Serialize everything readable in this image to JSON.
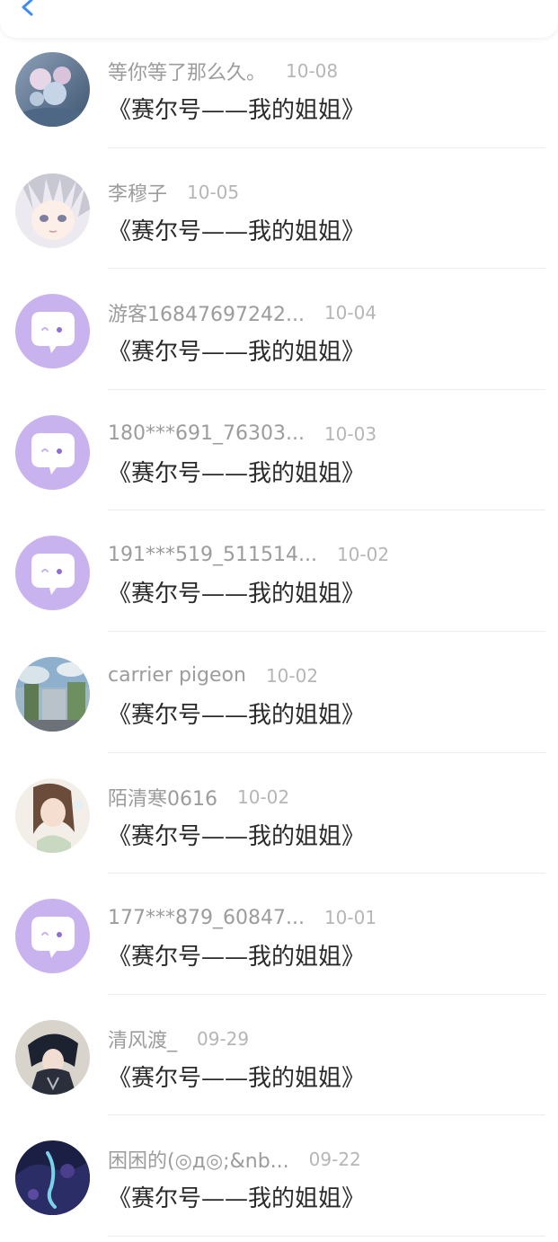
{
  "header": {
    "back_icon": "chevron-left-icon",
    "accent_color": "#3d8bff"
  },
  "messages": [
    {
      "name": "等你等了那么久。",
      "date": "10-08",
      "text": "《赛尔号——我的姐姐》",
      "avatar": "photo-avatar"
    },
    {
      "name": "李穆子",
      "date": "10-05",
      "text": "《赛尔号——我的姐姐》",
      "avatar": "anime-avatar"
    },
    {
      "name": "游客16847697242...",
      "date": "10-04",
      "text": "《赛尔号——我的姐姐》",
      "avatar": "default-chat-avatar"
    },
    {
      "name": "180***691_76303...",
      "date": "10-03",
      "text": "《赛尔号——我的姐姐》",
      "avatar": "default-chat-avatar"
    },
    {
      "name": "191***519_511514...",
      "date": "10-02",
      "text": "《赛尔号——我的姐姐》",
      "avatar": "default-chat-avatar"
    },
    {
      "name": "carrier pigeon",
      "date": "10-02",
      "text": "《赛尔号——我的姐姐》",
      "avatar": "photo-avatar"
    },
    {
      "name": "陌清寒0616",
      "date": "10-02",
      "text": "《赛尔号——我的姐姐》",
      "avatar": "anime-avatar"
    },
    {
      "name": "177***879_60847...",
      "date": "10-01",
      "text": "《赛尔号——我的姐姐》",
      "avatar": "default-chat-avatar"
    },
    {
      "name": "清风渡_",
      "date": "09-29",
      "text": "《赛尔号——我的姐姐》",
      "avatar": "anime-avatar"
    },
    {
      "name": "困困的(◎д◎;&nb...",
      "date": "09-22",
      "text": "《赛尔号——我的姐姐》",
      "avatar": "anime-avatar"
    }
  ],
  "colors": {
    "default_avatar_bg": "#c9b3ef",
    "name_text": "#9c9c9c",
    "date_text": "#b6b6b6",
    "message_text": "#2a2a2a"
  }
}
